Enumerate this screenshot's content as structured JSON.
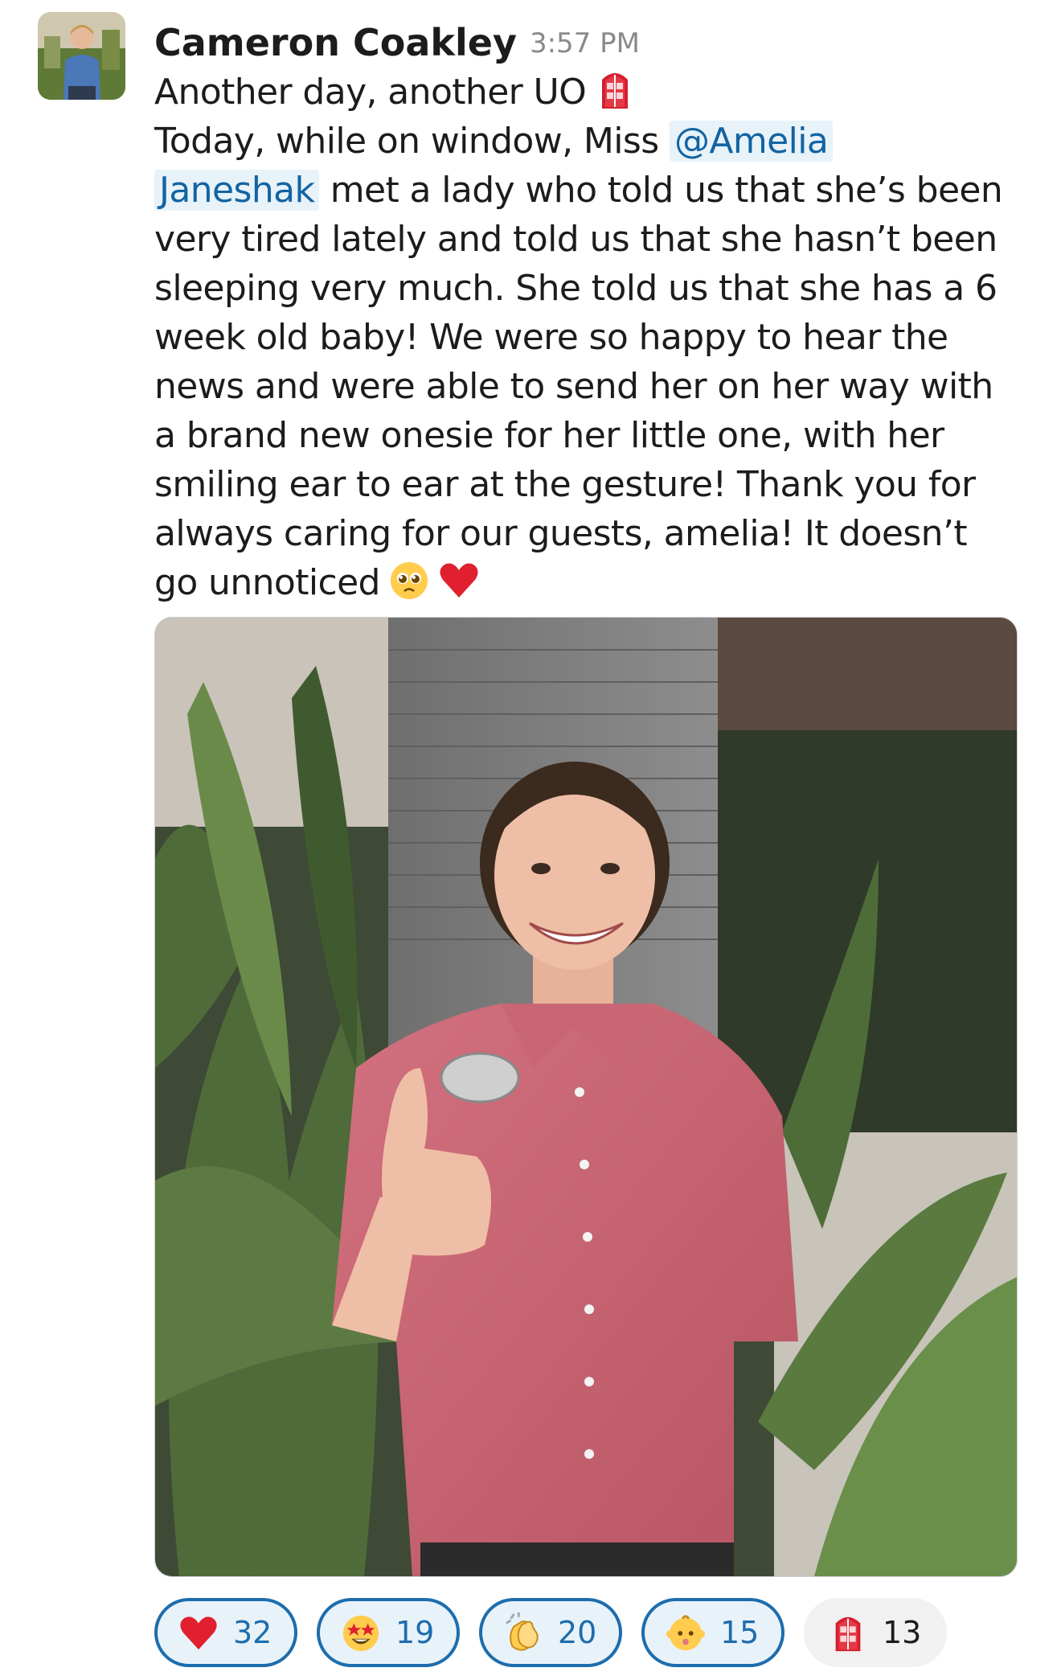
{
  "message": {
    "author": "Cameron Coakley",
    "timestamp": "3:57 PM",
    "avatar_icon": "profile-photo",
    "body": {
      "line1": "Another day, another UO",
      "line2_before_mention": "Today, while on window, Miss ",
      "mention_part1": "@Amelia",
      "mention_part2": "Janeshak",
      "line3_after_mention": " met a lady who told us that she’s been",
      "line4": "very tired lately and told us that she hasn’t been",
      "line5": "sleeping very much. She told us that she has a 6",
      "line6": "week old baby! We were so happy to hear the",
      "line7": "news and were able to send her on her way with",
      "line8": "a brand new onesie for her little one, with her",
      "line9": "smiling ear to ear at the gesture! Thank you for",
      "line10": "always caring for our guests, amelia! It doesn’t",
      "line11": "go unnoticed"
    },
    "inline_emojis": [
      "red-door-icon",
      "pleading-face-icon",
      "red-heart-icon"
    ],
    "attachment": {
      "type": "photo",
      "subject": "smiling employee in pink shirt giving thumbs up"
    }
  },
  "reactions": [
    {
      "icon": "red-heart-icon",
      "count": "32",
      "selected": true
    },
    {
      "icon": "star-struck-icon",
      "count": "19",
      "selected": true
    },
    {
      "icon": "clapping-hands-icon",
      "count": "20",
      "selected": true
    },
    {
      "icon": "baby-icon",
      "count": "15",
      "selected": true
    },
    {
      "icon": "red-door-icon",
      "count": "13",
      "selected": false
    }
  ],
  "colors": {
    "mention_bg": "#e8f2f9",
    "mention_text": "#1264a3",
    "reaction_selected_border": "#1d6dad",
    "reaction_plain_bg": "#f1f1f1"
  }
}
